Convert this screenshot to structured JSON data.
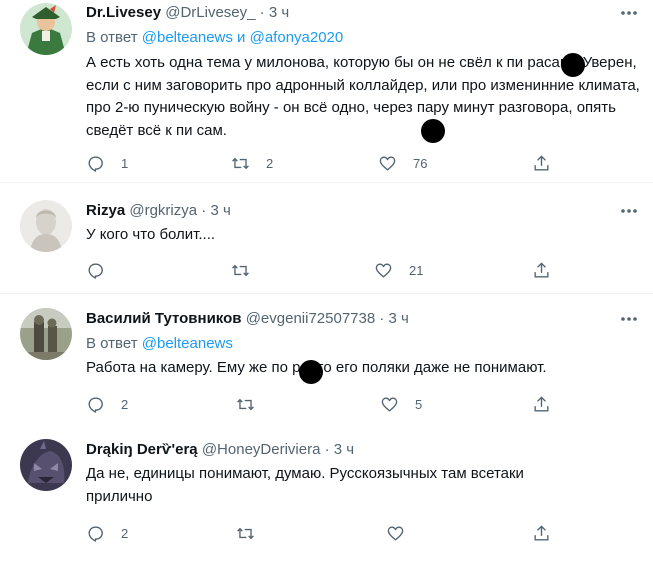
{
  "tweets": [
    {
      "name": "Dr.Livesey",
      "handle": "@DrLivesey_",
      "sep": "·",
      "time": "3 ч",
      "reply_prefix": "В ответ",
      "reply_user1": "@belteanews",
      "reply_and": "и",
      "reply_user2": "@afonya2020",
      "text": "А есть хоть одна тема у милонова, которую бы он не свёл к пи   расам? Уверен, если с ним заговорить про адронный коллайдер, или про изменинние климата, про 2-ю пуническую войну - он всё одно, через пару минут разговора, опять сведёт всё к пи   сам.",
      "reply_count": "1",
      "retweet_count": "2",
      "like_count": "76"
    },
    {
      "name": "Rizya",
      "handle": "@rgkrizya",
      "sep": "·",
      "time": "3 ч",
      "text": "У кого что болит....",
      "reply_count": "",
      "retweet_count": "",
      "like_count": "21"
    },
    {
      "name": "Василий Тутовников",
      "handle": "@evgenii72507738",
      "sep": "·",
      "time": "3 ч",
      "reply_prefix": "В ответ",
      "reply_user1": "@belteanews",
      "text": "Работа на камеру. Ему же по   р, что его поляки даже не понимают.",
      "reply_count": "2",
      "retweet_count": "",
      "like_count": "5"
    },
    {
      "name": "Drąkіŋ Derѷ'erą",
      "handle": "@HoneyDeriviera",
      "sep": "·",
      "time": "3 ч",
      "text": "Да не, единицы понимают, думаю. Русскоязычных там всетаки прилично",
      "reply_count": "2",
      "retweet_count": "",
      "like_count": ""
    }
  ],
  "icons": {
    "more": "more-horizontal-icon",
    "reply": "reply-icon",
    "retweet": "retweet-icon",
    "like": "heart-icon",
    "share": "share-icon"
  },
  "colors": {
    "text": "#0f1419",
    "muted": "#536471",
    "link": "#1d9bf0",
    "divider": "#eff3f4"
  }
}
